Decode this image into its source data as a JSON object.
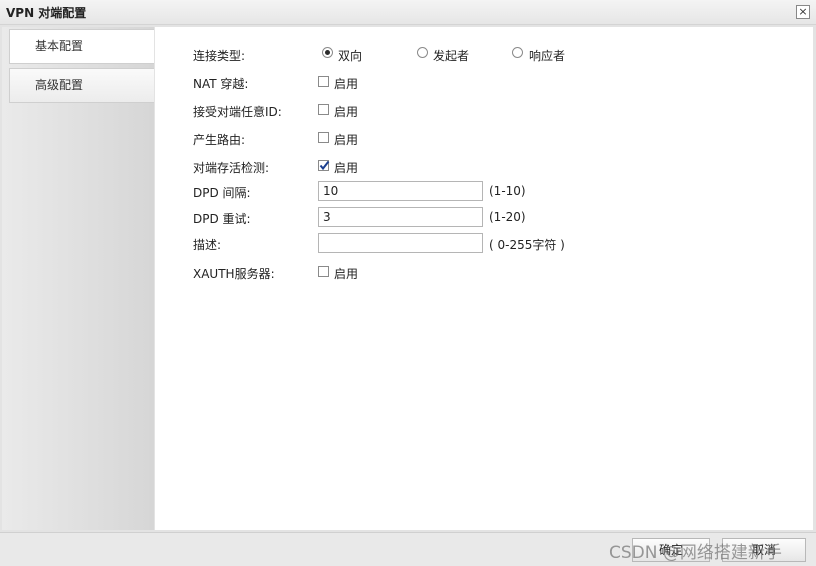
{
  "window": {
    "title": "VPN 对端配置",
    "close_icon": "close-icon"
  },
  "sidebar": {
    "tabs": [
      {
        "label": "基本配置"
      },
      {
        "label": "高级配置"
      }
    ]
  },
  "form": {
    "connection_type": {
      "label": "连接类型:",
      "options": [
        {
          "label": "双向",
          "selected": true
        },
        {
          "label": "发起者",
          "selected": false
        },
        {
          "label": "响应者",
          "selected": false
        }
      ]
    },
    "nat_traversal": {
      "label": "NAT 穿越:",
      "checkbox_label": "启用",
      "checked": false
    },
    "accept_any_peer_id": {
      "label": "接受对端任意ID:",
      "checkbox_label": "启用",
      "checked": false
    },
    "generate_route": {
      "label": "产生路由:",
      "checkbox_label": "启用",
      "checked": false
    },
    "peer_alive_detection": {
      "label": "对端存活检测:",
      "checkbox_label": "启用",
      "checked": true
    },
    "dpd_interval": {
      "label": "DPD 间隔:",
      "value": "10",
      "hint": "(1-10)"
    },
    "dpd_retry": {
      "label": "DPD 重试:",
      "value": "3",
      "hint": "(1-20)"
    },
    "description": {
      "label": "描述:",
      "value": "",
      "hint": "( 0-255字符 )"
    },
    "xauth_server": {
      "label": "XAUTH服务器:",
      "checkbox_label": "启用",
      "checked": false
    }
  },
  "footer": {
    "ok_label": "确定",
    "cancel_label": "取消"
  },
  "watermark": {
    "text": "CSDN @网络搭建新手"
  }
}
